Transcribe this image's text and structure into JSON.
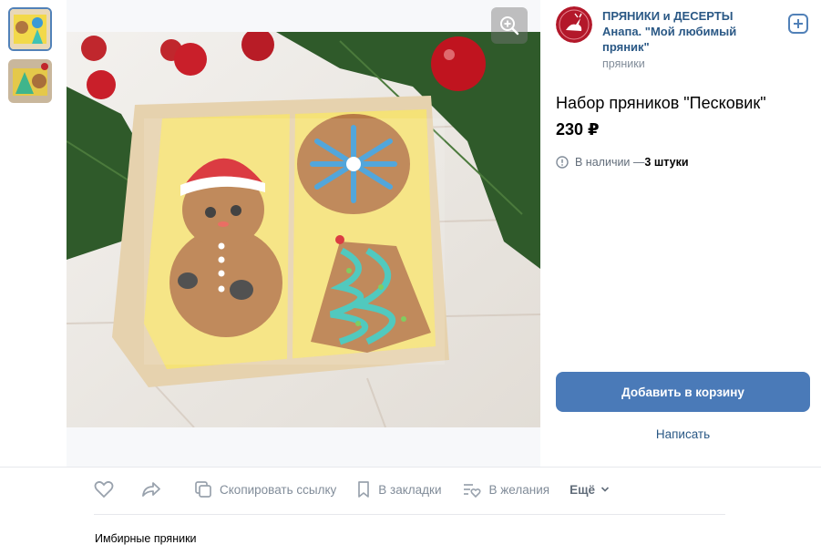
{
  "shop": {
    "name": "ПРЯНИКИ и ДЕСЕРТЫ Анапа. \"Мой любимый пряник\"",
    "category": "пряники"
  },
  "product": {
    "title": "Набор пряников \"Песковик\"",
    "price": "230 ₽",
    "availability_prefix": "В наличии — ",
    "availability_count": "3 штуки"
  },
  "buttons": {
    "add_to_cart": "Добавить в корзину",
    "write": "Написать"
  },
  "actions": {
    "copy_link": "Скопировать ссылку",
    "bookmarks": "В закладки",
    "wishlist": "В желания",
    "more": "Ещё"
  },
  "description": "Имбирные пряники",
  "colors": {
    "accent": "#4a7ab8",
    "link": "#2a5885",
    "muted": "#818c99"
  }
}
